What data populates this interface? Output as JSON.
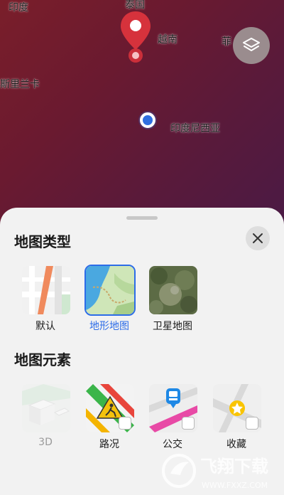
{
  "map": {
    "labels": {
      "india": "印度",
      "thailand": "泰国",
      "vietnam": "越南",
      "philippines": "菲",
      "sri_lanka": "斯里兰卡",
      "indonesia": "印度尼西亚"
    },
    "colors": {
      "pin": "#d6323c",
      "location_dot": "#2f6fe0"
    },
    "layers_button_icon": "layers-icon"
  },
  "sheet": {
    "map_types_title": "地图类型",
    "close_icon": "close-icon",
    "map_types": [
      {
        "label": "默认",
        "selected": false
      },
      {
        "label": "地形地图",
        "selected": true
      },
      {
        "label": "卫星地图",
        "selected": false
      }
    ],
    "map_elements_title": "地图元素",
    "map_elements": [
      {
        "label": "3D",
        "enabled": false
      },
      {
        "label": "路况",
        "enabled": true
      },
      {
        "label": "公交",
        "enabled": true
      },
      {
        "label": "收藏",
        "enabled": true
      }
    ],
    "accent_color": "#2c6ce8"
  },
  "watermark": {
    "text": "飞翔下载",
    "url_text": "WWW.FXXZ.COM"
  }
}
